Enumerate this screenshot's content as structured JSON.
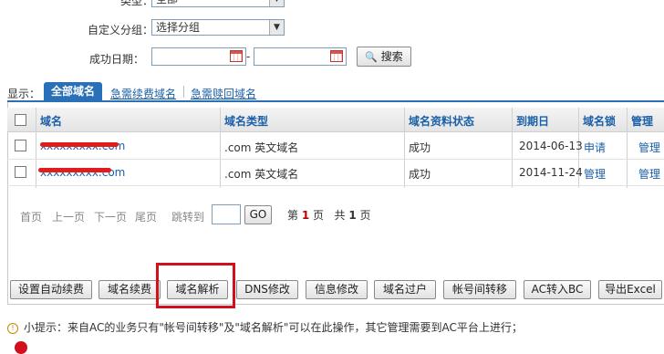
{
  "filters": {
    "type_label": "类型：",
    "type_value": "全部",
    "group_label": "自定义分组：",
    "group_value": "选择分组",
    "date_label": "成功日期：",
    "date_separator": "-",
    "search_label": "搜索"
  },
  "tabs": {
    "display_label": "显示：",
    "items": [
      "全部域名",
      "急需续费域名",
      "急需赎回域名"
    ]
  },
  "table": {
    "headers": [
      "域名",
      "域名类型",
      "域名资料状态",
      "到期日",
      "域名锁",
      "管理"
    ],
    "rows": [
      {
        "domain": "xxxxxxxxx.com",
        "type": ".com 英文域名",
        "status": "成功",
        "expires": "2014-06-13",
        "lock": "申请",
        "manage": "管理"
      },
      {
        "domain": "xxxxxxxxx.com",
        "type": ".com 英文域名",
        "status": "成功",
        "expires": "2014-11-24",
        "lock": "管理",
        "manage": "管理"
      }
    ]
  },
  "pagination": {
    "first": "首页",
    "prev": "上一页",
    "next": "下一页",
    "last": "尾页",
    "jump_label": "跳转到",
    "go": "GO",
    "page_prefix": "第",
    "page_current": "1",
    "page_suffix": "页",
    "total_prefix": "共",
    "total": "1",
    "total_suffix": "页"
  },
  "actions": [
    "设置自动续费",
    "域名续费",
    "域名解析",
    "DNS修改",
    "信息修改",
    "域名过户",
    "帐号间转移",
    "AC转入BC",
    "导出Excel"
  ],
  "tip": "小提示：来自AC的业务只有\"帐号间转移\"及\"域名解析\"可以在此操作，其它管理需要到AC平台上进行；",
  "colors": {
    "accent": "#2a70b8",
    "link": "#1a5fa8",
    "highlight": "#d0101c"
  }
}
